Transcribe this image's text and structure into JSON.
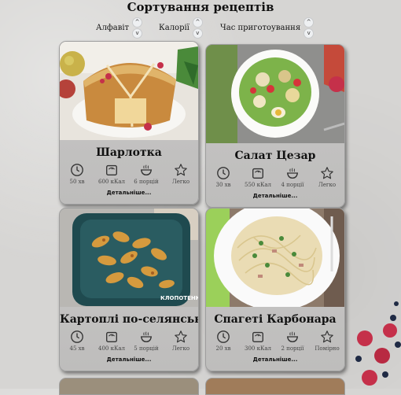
{
  "page": {
    "title": "Сортування рецептів"
  },
  "sort": {
    "alphabet": "Алфавіт",
    "calories": "Калорії",
    "time": "Час приготоування",
    "up_arrow": "^",
    "down_arrow": "v"
  },
  "details_label": "Детальніше...",
  "recipes": [
    {
      "title": "Шарлотка",
      "time": "50 хв",
      "calories": "600 кКал",
      "portions": "6 порцій",
      "difficulty": "Легко"
    },
    {
      "title": "Салат Цезар",
      "time": "30 хв",
      "calories": "550 кКал",
      "portions": "4 порції",
      "difficulty": "Легко"
    },
    {
      "title": "Картоплі по-селянськи",
      "time": "45 хв",
      "calories": "400 кКал",
      "portions": "5 порцій",
      "difficulty": "Легко",
      "photo_watermark": "КЛОПОТЕНКО"
    },
    {
      "title": "Спагеті Карбонара",
      "time": "20 хв",
      "calories": "300 кКал",
      "portions": "2 порції",
      "difficulty": "Помірно"
    }
  ],
  "icons": {
    "time": "clock-icon",
    "calories": "scale-icon",
    "portions": "bowl-icon",
    "difficulty": "star-icon"
  },
  "colors": {
    "background": "#d6d5d3",
    "card": "#c4c3c2",
    "berry": "#c5304a"
  }
}
